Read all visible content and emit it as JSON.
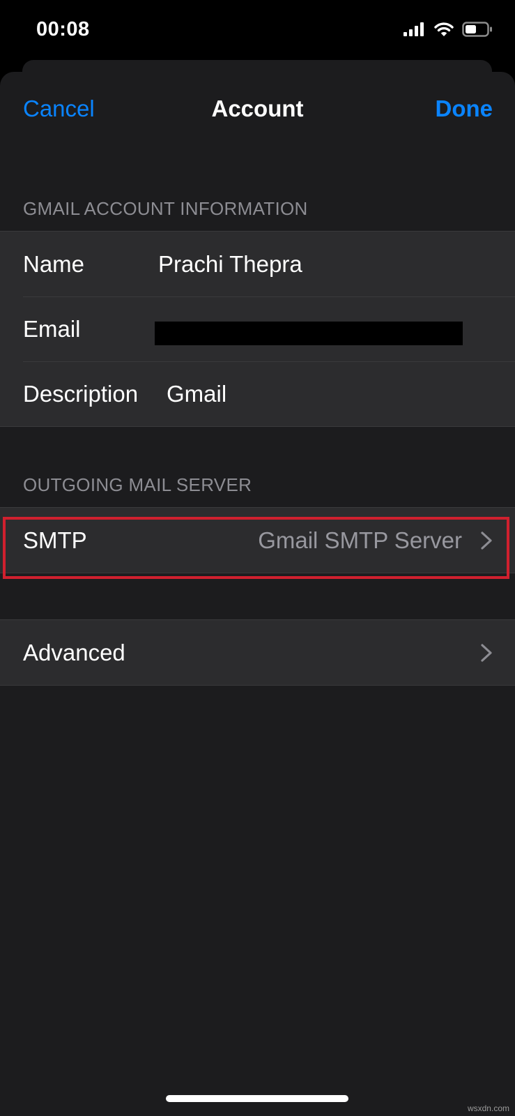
{
  "status_bar": {
    "time": "00:08",
    "icons": [
      "cellular-signal-icon",
      "wifi-icon",
      "battery-icon"
    ]
  },
  "nav": {
    "cancel_label": "Cancel",
    "title": "Account",
    "done_label": "Done"
  },
  "account_section": {
    "header": "GMAIL ACCOUNT INFORMATION",
    "rows": [
      {
        "label": "Name",
        "value": "Prachi Thepra"
      },
      {
        "label": "Email",
        "value": ""
      },
      {
        "label": "Description",
        "value": "Gmail"
      }
    ]
  },
  "outgoing_section": {
    "header": "OUTGOING MAIL SERVER",
    "smtp": {
      "label": "SMTP",
      "value": "Gmail SMTP Server"
    }
  },
  "advanced": {
    "label": "Advanced"
  },
  "colors": {
    "accent": "#0a84ff",
    "highlight": "#d0202e",
    "background": "#1c1c1e",
    "cell": "#2c2c2e"
  },
  "watermark": "wsxdn.com"
}
